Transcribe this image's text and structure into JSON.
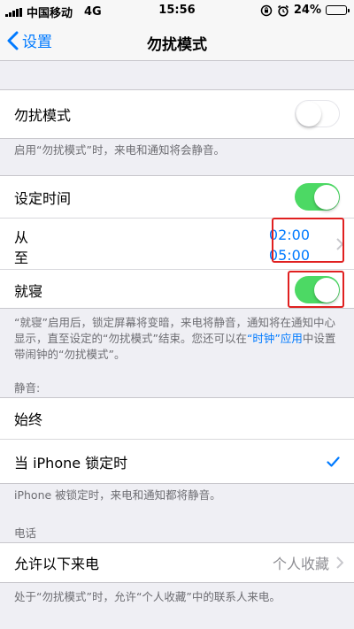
{
  "status": {
    "carrier": "中国移动",
    "network": "4G",
    "time": "15:56",
    "battery": "24%",
    "battery_level": 0.24
  },
  "nav": {
    "back_label": "设置",
    "title": "勿扰模式"
  },
  "dnd": {
    "label": "勿扰模式",
    "enabled": false,
    "footnote": "启用“勿扰模式”时，来电和通知将会静音。"
  },
  "schedule": {
    "label": "设定时间",
    "enabled": true,
    "from_label": "从",
    "to_label": "至",
    "from_time": "02:00",
    "to_time": "05:00",
    "bedtime_label": "就寝",
    "bedtime_enabled": true,
    "footnote_pre": "“就寝”启用后，锁定屏幕将变暗，来电将静音，通知将在通知中心显示，直至设定的“勿扰模式”结束。您还可以在",
    "footnote_link": "“时钟”应用",
    "footnote_post": "中设置带闹钟的“勿扰模式”。"
  },
  "silence": {
    "header": "静音:",
    "always_label": "始终",
    "locked_label": "当 iPhone 锁定时",
    "selected": "locked",
    "footnote": "iPhone 被锁定时，来电和通知都将静音。"
  },
  "phone": {
    "header": "电话",
    "allow_label": "允许以下来电",
    "allow_value": "个人收藏",
    "footnote": "处于“勿扰模式”时，允许“个人收藏”中的联系人来电。"
  },
  "colors": {
    "accent": "#007aff",
    "toggle_on": "#4cd964",
    "highlight": "#e02020"
  }
}
